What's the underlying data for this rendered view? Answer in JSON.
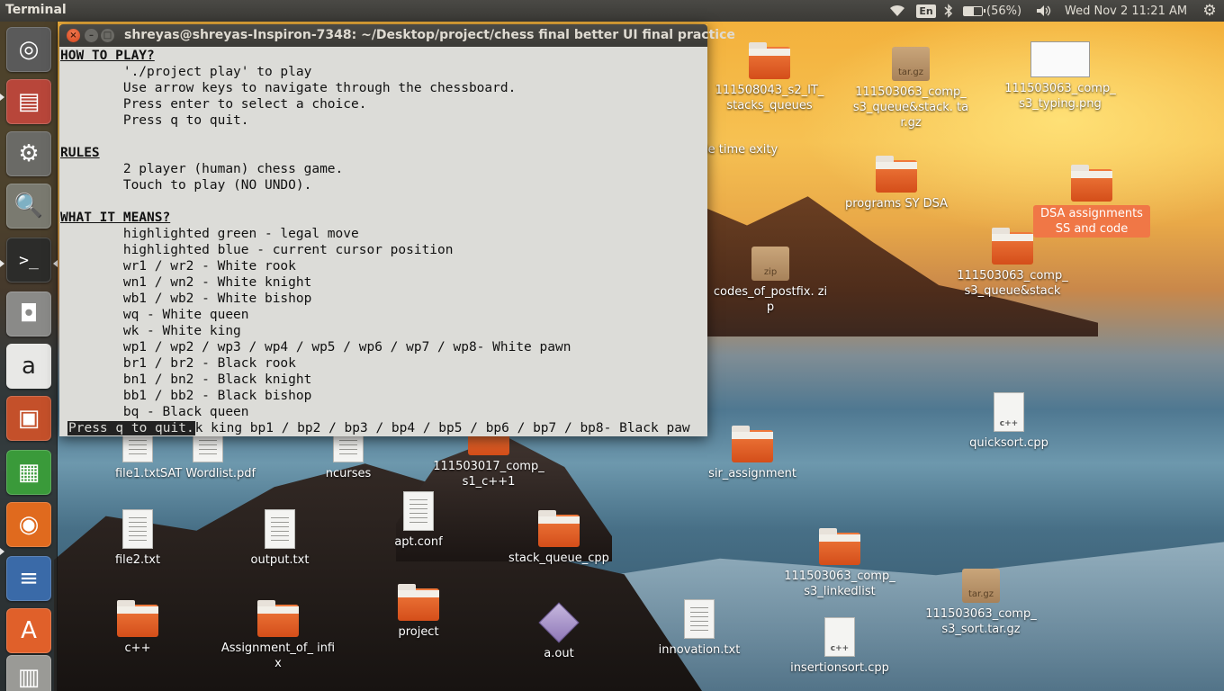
{
  "panel": {
    "app_title": "Terminal",
    "keyboard_layout": "En",
    "battery_text": "(56%)",
    "battery_level": 0.56,
    "clock": "Wed Nov 2 11:21 AM"
  },
  "launcher": {
    "items": [
      {
        "name": "ubuntu-dash",
        "glyph": "◎",
        "color": "#5a5a5a"
      },
      {
        "name": "files",
        "glyph": "▤",
        "color": "#b8463a"
      },
      {
        "name": "system-settings",
        "glyph": "⚙",
        "color": "#6a6a66"
      },
      {
        "name": "image-viewer",
        "glyph": "🔍",
        "color": "#7a7a70"
      },
      {
        "name": "terminal",
        "glyph": ">_",
        "color": "#2c2c2a"
      },
      {
        "name": "disk-drive",
        "glyph": "◘",
        "color": "#8a8a88"
      },
      {
        "name": "amazon",
        "glyph": "a",
        "color": "#e8e8e6"
      },
      {
        "name": "impress",
        "glyph": "▣",
        "color": "#c4502a"
      },
      {
        "name": "calc",
        "glyph": "▦",
        "color": "#3a9a3a"
      },
      {
        "name": "firefox",
        "glyph": "◉",
        "color": "#e06a1e"
      },
      {
        "name": "writer",
        "glyph": "≡",
        "color": "#3a6aa8"
      },
      {
        "name": "software-center",
        "glyph": "A",
        "color": "#e0602a"
      },
      {
        "name": "workspace-switcher",
        "glyph": "▥",
        "color": "#9a9a96"
      }
    ]
  },
  "desktop": {
    "icons": [
      {
        "type": "folder",
        "label": "111508043_s2_IT_ stacks_queues"
      },
      {
        "type": "archive",
        "glyph_text": "tar.gz",
        "label": "111503063_comp_ s3_queue&stack. tar.gz"
      },
      {
        "type": "thumb",
        "label": "111503063_comp_ s3_typing.png"
      },
      {
        "type": "folder",
        "label": "programs SY DSA"
      },
      {
        "type": "folder",
        "label": "DSA assignments SS and code",
        "selected": true
      },
      {
        "type": "archive",
        "glyph_text": "zip",
        "label": "codes_of_postfix. zip"
      },
      {
        "type": "folder",
        "label": "111503063_comp_ s3_queue&stack"
      },
      {
        "type": "cpp",
        "glyph_text": "c++",
        "label": "quicksort.cpp"
      },
      {
        "type": "folder",
        "label": "sir_assignment"
      },
      {
        "type": "doc",
        "label": "SAT Wordlist.pdf"
      },
      {
        "type": "doc",
        "label": "ncurses"
      },
      {
        "type": "folder",
        "label": "111503017_comp_ s1_c++1"
      },
      {
        "type": "doc",
        "label": "file1.txt"
      },
      {
        "type": "doc",
        "label": "file2.txt"
      },
      {
        "type": "doc",
        "label": "output.txt"
      },
      {
        "type": "doc",
        "label": "apt.conf"
      },
      {
        "type": "folder",
        "label": "stack_queue_cpp"
      },
      {
        "type": "folder",
        "label": "111503063_comp_ s3_linkedlist"
      },
      {
        "type": "archive",
        "glyph_text": "tar.gz",
        "label": "111503063_comp_ s3_sort.tar.gz"
      },
      {
        "type": "folder",
        "label": "c++"
      },
      {
        "type": "folder",
        "label": "Assignment_of_ infix"
      },
      {
        "type": "folder",
        "label": "project"
      },
      {
        "type": "exec",
        "label": "a.out"
      },
      {
        "type": "doc",
        "label": "innovation.txt"
      },
      {
        "type": "cpp",
        "glyph_text": "c++",
        "label": "insertionsort.cpp"
      },
      {
        "type": "partial",
        "label": "nt code  time exity"
      }
    ]
  },
  "terminal": {
    "title": "shreyas@shreyas-Inspiron-7348: ~/Desktop/project/chess final  better UI final practice",
    "close_glyph": "×",
    "minimize_glyph": "–",
    "maximize_glyph": "□",
    "lines": [
      {
        "text": "HOW TO PLAY?",
        "head": true
      },
      {
        "text": "        './project play' to play"
      },
      {
        "text": "        Use arrow keys to navigate through the chessboard."
      },
      {
        "text": "        Press enter to select a choice."
      },
      {
        "text": "        Press q to quit."
      },
      {
        "text": ""
      },
      {
        "text": "RULES",
        "head": true
      },
      {
        "text": "        2 player (human) chess game."
      },
      {
        "text": "        Touch to play (NO UNDO)."
      },
      {
        "text": ""
      },
      {
        "text": "WHAT IT MEANS?",
        "head": true
      },
      {
        "text": "        highlighted green - legal move"
      },
      {
        "text": "        highlighted blue - current cursor position"
      },
      {
        "text": "        wr1 / wr2 - White rook"
      },
      {
        "text": "        wn1 / wn2 - White knight"
      },
      {
        "text": "        wb1 / wb2 - White bishop"
      },
      {
        "text": "        wq - White queen"
      },
      {
        "text": "        wk - White king"
      },
      {
        "text": "        wp1 / wp2 / wp3 / wp4 / wp5 / wp6 / wp7 / wp8- White pawn"
      },
      {
        "text": "        br1 / br2 - Black rook"
      },
      {
        "text": "        bn1 / bn2 - Black knight"
      },
      {
        "text": "        bb1 / bb2 - Black bishop"
      },
      {
        "text": "        bq - Black queen"
      }
    ],
    "status_prompt": "Press q to quit.",
    "status_rest": "k king bp1 / bp2 / bp3 / bp4 / bp5 / bp6 / bp7 / bp8- Black paw"
  }
}
